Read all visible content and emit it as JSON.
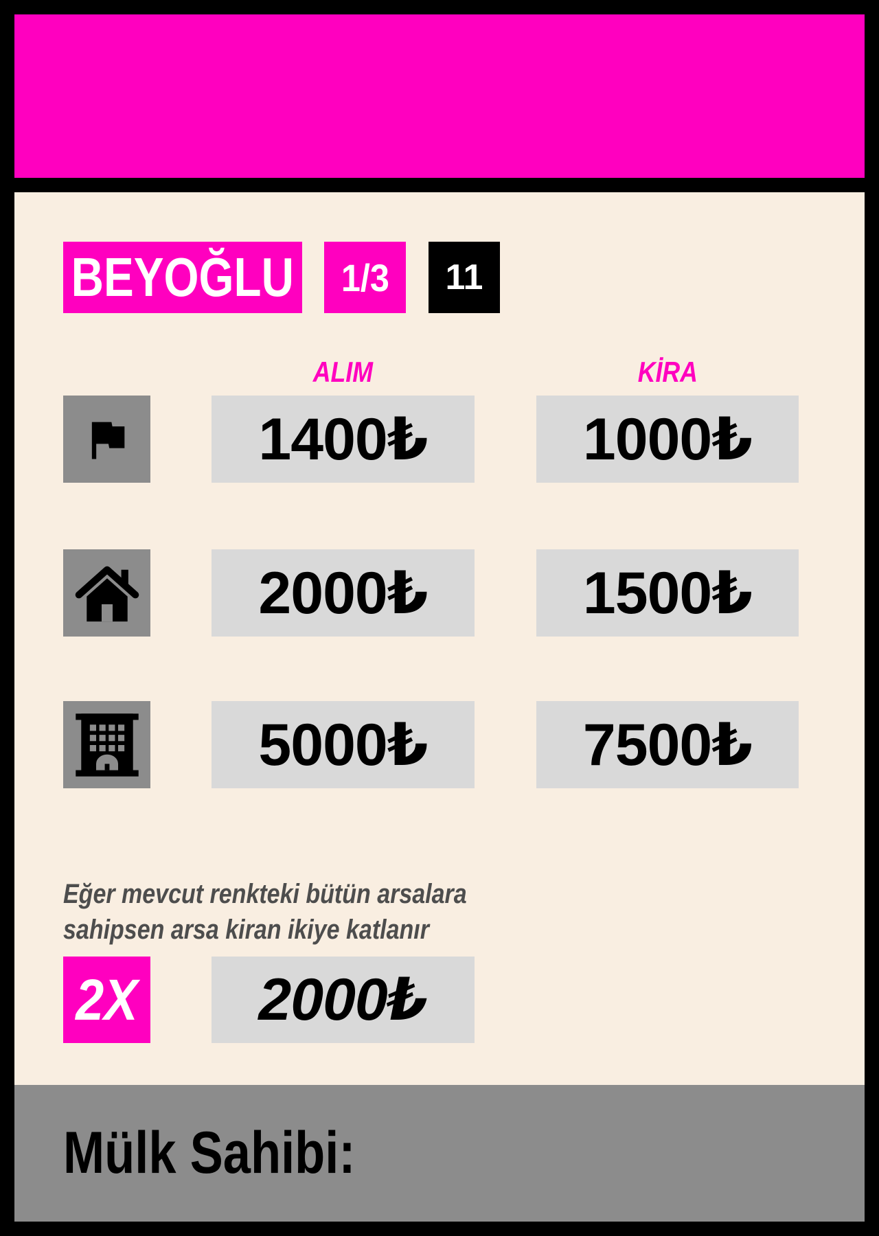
{
  "colors": {
    "accent": "#ff00bf",
    "card_background": "#f9eee1",
    "value_box": "#d9d9d9",
    "icon_box": "#8c8c8c",
    "footer": "#8c8c8c",
    "frame": "#000000"
  },
  "property": {
    "name": "BEYOĞLU",
    "group": "1/3",
    "number": "11"
  },
  "columns": {
    "buy": "ALIM",
    "rent": "KİRA"
  },
  "rows": [
    {
      "icon": "flag-icon",
      "buy": "1400₺",
      "rent": "1000₺"
    },
    {
      "icon": "house-icon",
      "buy": "2000₺",
      "rent": "1500₺"
    },
    {
      "icon": "building-icon",
      "buy": "5000₺",
      "rent": "7500₺"
    }
  ],
  "bonus": {
    "note_lines": [
      "Eğer mevcut renkteki bütün arsalara",
      "sahipsen arsa kiran ikiye katlanır"
    ],
    "multiplier": "2X",
    "value": "2000₺"
  },
  "footer": {
    "owner_label": "Mülk Sahibi:"
  }
}
